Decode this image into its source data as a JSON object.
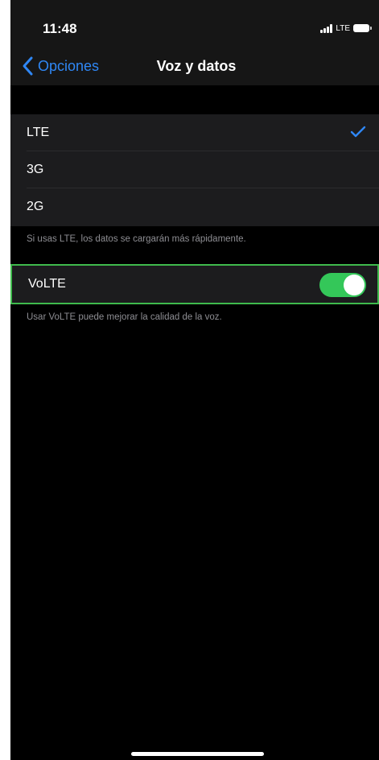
{
  "status_bar": {
    "time": "11:48",
    "network": "LTE",
    "signal_icon": "cellular-signal-icon",
    "battery_icon": "battery-icon"
  },
  "nav": {
    "back_label": "Opciones",
    "back_icon": "chevron-left-icon",
    "title": "Voz y datos"
  },
  "network_options": {
    "items": [
      {
        "label": "LTE",
        "selected": true
      },
      {
        "label": "3G",
        "selected": false
      },
      {
        "label": "2G",
        "selected": false
      }
    ],
    "check_icon": "checkmark-icon",
    "footer": "Si usas LTE, los datos se cargarán más rápidamente."
  },
  "volte": {
    "label": "VoLTE",
    "enabled": true,
    "footer": "Usar VoLTE puede mejorar la calidad de la voz."
  },
  "colors": {
    "accent": "#2f87f5",
    "toggle_on": "#34c759",
    "highlight_border": "#3fba4d",
    "background": "#000000",
    "cell_background": "#1c1c1e",
    "secondary_text": "#8e8e93"
  }
}
